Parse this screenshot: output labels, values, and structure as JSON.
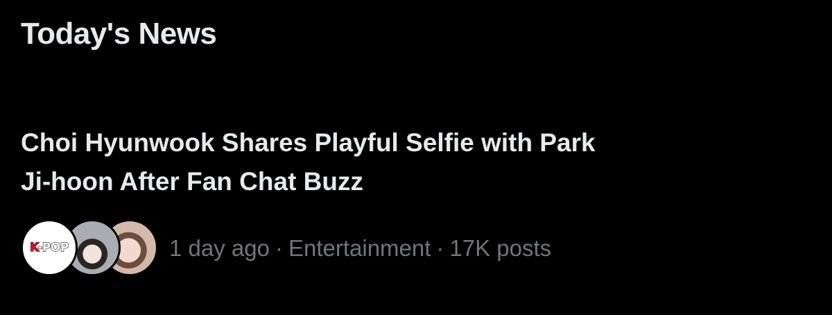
{
  "section": {
    "title": "Today's News"
  },
  "news_item": {
    "headline": "Choi Hyunwook Shares Playful Selfie with Park Ji-hoon After Fan Chat Buzz",
    "avatars": [
      {
        "name": "K-POP account",
        "logo_text_k": "K",
        "logo_text_rest": "-POP"
      },
      {
        "name": "person avatar"
      },
      {
        "name": "person avatar"
      }
    ],
    "meta": {
      "time": "1 day ago",
      "separator": "·",
      "category": "Entertainment",
      "posts": "17K posts"
    }
  },
  "colors": {
    "background": "#000000",
    "primary_text": "#e7e9ea",
    "secondary_text": "#71767b",
    "kpop_red": "#e0112b"
  }
}
